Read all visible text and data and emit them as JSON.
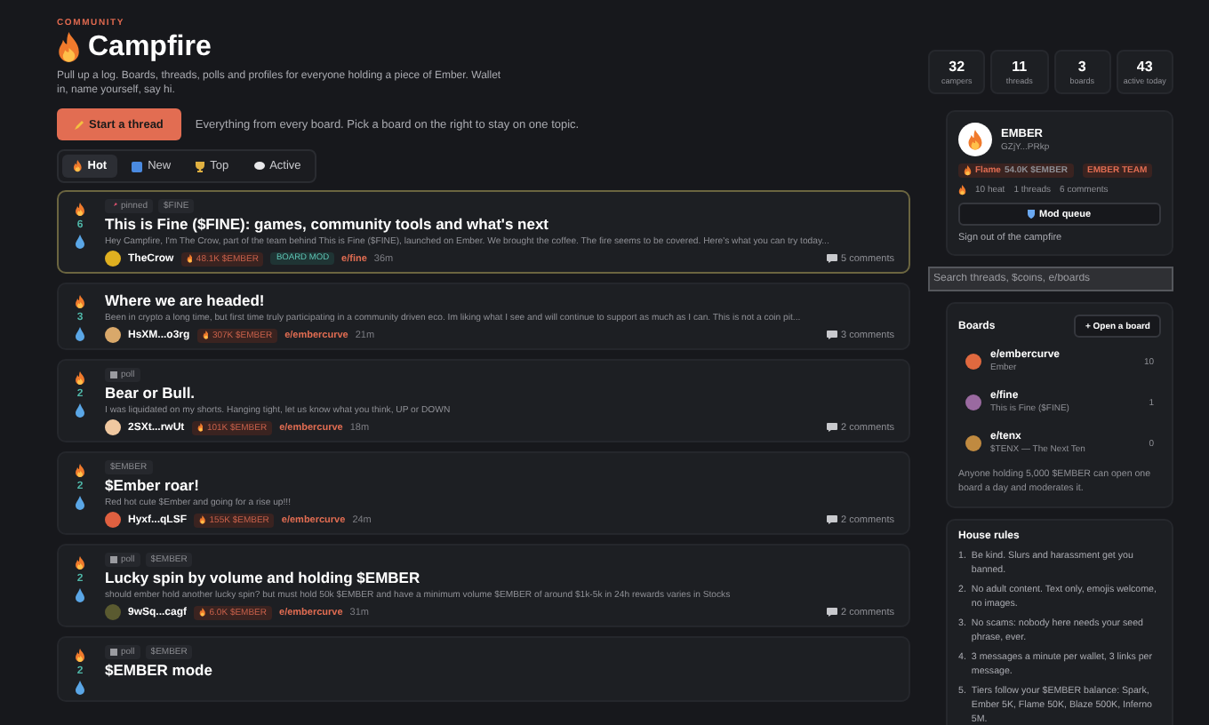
{
  "header": {
    "eyebrow": "COMMUNITY",
    "title": "Campfire",
    "description": "Pull up a log. Boards, threads, polls and profiles for everyone holding a piece of Ember. Wallet in, name yourself, say hi."
  },
  "stats": [
    {
      "value": "32",
      "label": "campers"
    },
    {
      "value": "11",
      "label": "threads"
    },
    {
      "value": "3",
      "label": "boards"
    },
    {
      "value": "43",
      "label": "active today"
    }
  ],
  "start_button": "Start a thread",
  "hint": "Everything from every board. Pick a board on the right to stay on one topic.",
  "sort_tabs": [
    {
      "kind": "hot",
      "label": "Hot",
      "selected": true
    },
    {
      "kind": "new",
      "label": "New",
      "selected": false
    },
    {
      "kind": "top",
      "label": "Top",
      "selected": false
    },
    {
      "kind": "active",
      "label": "Active",
      "selected": false
    }
  ],
  "posts": [
    {
      "pinned": true,
      "votes": "6",
      "tags": [
        {
          "kind": "pinned",
          "label": "pinned"
        },
        {
          "kind": "plain",
          "label": "$FINE"
        }
      ],
      "title": "This is Fine ($FINE): games, community tools and what's next",
      "body": "Hey Campfire, I'm The Crow, part of the team behind This is Fine ($FINE), launched on Ember. We brought the coffee. The fire seems to be covered. Here's what you can try today...",
      "color": "#e0b020",
      "author": "TheCrow",
      "tier": "48.1K $EMBER",
      "role": "BOARD MOD",
      "board": "e/fine",
      "time": "36m",
      "comments": "5 comments"
    },
    {
      "pinned": false,
      "votes": "3",
      "title": "Where we are headed!",
      "body": "Been in crypto a long time, but first time truly participating in a community driven eco. Im liking what I see and will continue to support as much as I can. This is not a coin pit...",
      "color": "#d9a86a",
      "author": "HsXM...o3rg",
      "tier": "307K $EMBER",
      "board": "e/embercurve",
      "time": "21m",
      "comments": "3 comments"
    },
    {
      "pinned": false,
      "votes": "2",
      "tags": [
        {
          "kind": "poll",
          "label": "poll"
        }
      ],
      "title": "Bear or Bull.",
      "body": "I was liquidated on my shorts. Hanging tight, let us know what you think, UP or DOWN",
      "color": "#f0c8a0",
      "author": "2SXt...rwUt",
      "tier": "101K $EMBER",
      "board": "e/embercurve",
      "time": "18m",
      "comments": "2 comments"
    },
    {
      "pinned": false,
      "votes": "2",
      "tags": [
        {
          "kind": "plain",
          "label": "$EMBER"
        }
      ],
      "title": "$Ember roar!",
      "body": "Red hot cute $Ember and going for a rise up!!!",
      "color": "#e06040",
      "author": "Hyxf...qLSF",
      "tier": "155K $EMBER",
      "board": "e/embercurve",
      "time": "24m",
      "comments": "2 comments"
    },
    {
      "pinned": false,
      "votes": "2",
      "tags": [
        {
          "kind": "poll",
          "label": "poll"
        },
        {
          "kind": "plain",
          "label": "$EMBER"
        }
      ],
      "title": "Lucky spin by volume and holding $EMBER",
      "body": "should ember hold another lucky spin? but must hold 50k $EMBER and have a minimum volume $EMBER of around $1k-5k in 24h rewards varies in Stocks",
      "color": "#5a5a30",
      "author": "9wSq...cagf",
      "tier": "6.0K $EMBER",
      "board": "e/embercurve",
      "time": "31m",
      "comments": "2 comments"
    },
    {
      "pinned": false,
      "votes": "2",
      "tags": [
        {
          "kind": "poll",
          "label": "poll"
        },
        {
          "kind": "plain",
          "label": "$EMBER"
        }
      ],
      "title": "$EMBER mode"
    }
  ],
  "profile": {
    "name": "EMBER",
    "address": "GZjY...PRkp",
    "tier": "Flame",
    "tier_amount": "54.0K $EMBER",
    "team": "EMBER TEAM",
    "stats": [
      "10 heat",
      "1 threads",
      "6 comments"
    ],
    "mod_button": "Mod queue",
    "sign_out": "Sign out of the campfire"
  },
  "search": {
    "placeholder": "Search threads, $coins, e/boards"
  },
  "boards": {
    "title": "Boards",
    "open_button": "+ Open a board",
    "items": [
      {
        "name": "e/embercurve",
        "subtitle": "Ember",
        "count": "10",
        "color": "#e0693f"
      },
      {
        "name": "e/fine",
        "subtitle": "This is Fine ($FINE)",
        "count": "1",
        "color": "#9a6aa0"
      },
      {
        "name": "e/tenx",
        "subtitle": "$TENX — The Next Ten",
        "count": "0",
        "color": "#c08a40"
      }
    ],
    "note": "Anyone holding 5,000 $EMBER can open one board a day and moderates it."
  },
  "rules": {
    "title": "House rules",
    "items": [
      {
        "number": "1.",
        "text": "Be kind. Slurs and harassment get you banned."
      },
      {
        "number": "2.",
        "text": "No adult content. Text only, emojis welcome, no images."
      },
      {
        "number": "3.",
        "text": "No scams: nobody here needs your seed phrase, ever."
      },
      {
        "number": "4.",
        "text": "3 messages a minute per wallet, 3 links per message."
      },
      {
        "number": "5.",
        "text": "Tiers follow your $EMBER balance: Spark, Ember 5K, Flame 50K, Blaze 500K, Inferno 5M."
      }
    ]
  }
}
